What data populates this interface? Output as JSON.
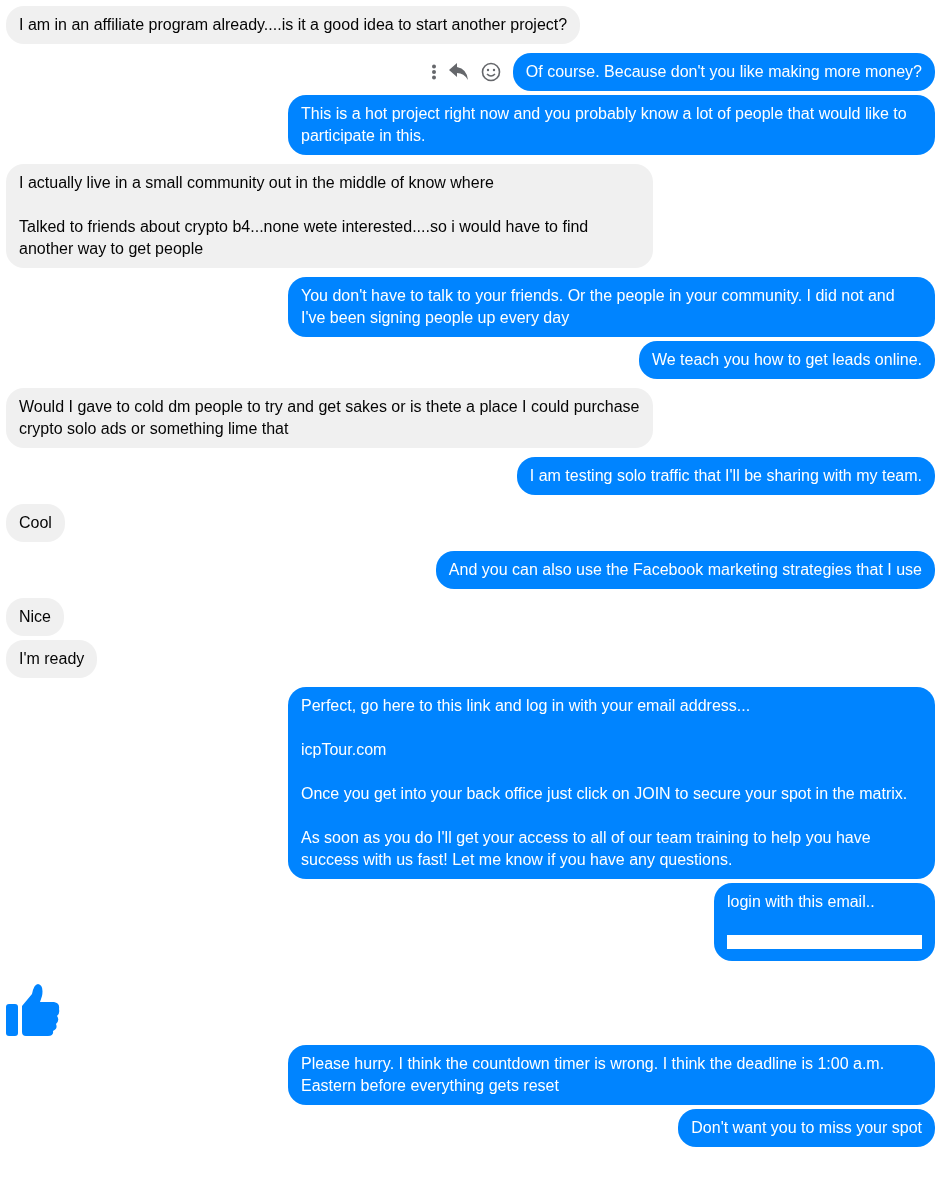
{
  "messages": [
    {
      "kind": "text",
      "outgoing": false,
      "text": "I am in an affiliate program already....is it a good idea to start another project?"
    },
    {
      "kind": "text",
      "outgoing": true,
      "text": "Of course. Because don't you like making more money?",
      "show_actions": true
    },
    {
      "kind": "text",
      "outgoing": true,
      "text": "This is a hot project right now and you probably know a lot of people that would like to participate in this."
    },
    {
      "kind": "text",
      "outgoing": false,
      "text": "I actually live in a small community out in the middle of know where\n\nTalked to friends about crypto b4...none wete interested....so i would have to find another way to get people"
    },
    {
      "kind": "text",
      "outgoing": true,
      "text": "You don't have to talk to your friends. Or the people in your community. I did not and I've been signing people up every day"
    },
    {
      "kind": "text",
      "outgoing": true,
      "text": "We teach you how to get leads online."
    },
    {
      "kind": "text",
      "outgoing": false,
      "text": "Would I gave to cold dm people to try and get sakes or is thete a place I could purchase crypto solo ads or something lime that"
    },
    {
      "kind": "text",
      "outgoing": true,
      "text": "I am testing solo traffic that I'll be sharing with my team."
    },
    {
      "kind": "text",
      "outgoing": false,
      "text": "Cool"
    },
    {
      "kind": "text",
      "outgoing": true,
      "text": "And you can also use the Facebook marketing strategies that I use"
    },
    {
      "kind": "text",
      "outgoing": false,
      "text": "Nice"
    },
    {
      "kind": "text",
      "outgoing": false,
      "text": "I'm ready"
    },
    {
      "kind": "text",
      "outgoing": true,
      "text": "Perfect, go here to this link and log in with your email address...\n\nicpTour.com\n\nOnce you get into your back office just click on JOIN to secure your spot in the matrix.\n\nAs soon as you do I'll get your access to all of our team training to help you have success with us fast! Let me know if you have any questions."
    },
    {
      "kind": "text",
      "outgoing": true,
      "text": "login with this email..",
      "redacted": true
    },
    {
      "kind": "like"
    },
    {
      "kind": "text",
      "outgoing": true,
      "text": "Please hurry. I think the countdown timer is wrong. I think the deadline is 1:00 a.m. Eastern before everything gets reset"
    },
    {
      "kind": "text",
      "outgoing": true,
      "text": "Don't want you to miss your spot"
    }
  ]
}
